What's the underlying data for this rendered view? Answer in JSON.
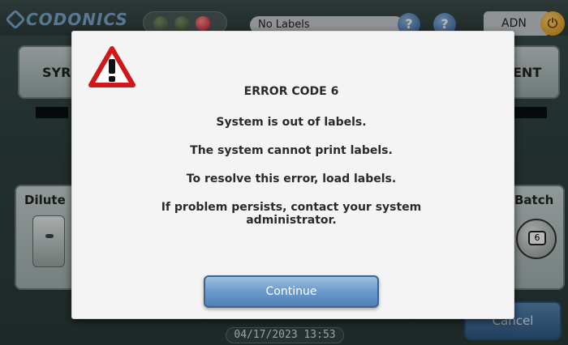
{
  "app": {
    "logo_text": "CODONICS",
    "label_status": "No Labels",
    "user": "ADN",
    "help_icon": "question-icon",
    "power_icon": "power-icon"
  },
  "background": {
    "left_tab_label": "SYR",
    "right_tab_label": "ENT",
    "left_panel_title": "Dilute",
    "right_panel_title": "Batch",
    "batch_count": "6",
    "cancel_label": "Cancel",
    "datetime": "04/17/2023 13:53"
  },
  "dialog": {
    "icon": "warning-triangle-icon",
    "error_code": "ERROR CODE 6",
    "line1": "System is out of labels.",
    "line2": "The system cannot print labels.",
    "line3": "To resolve this error, load labels.",
    "line4a": "If problem persists, contact your system",
    "line4b": "administrator.",
    "continue_label": "Continue"
  },
  "colors": {
    "accent": "#4f82b8",
    "warning_red": "#d01818",
    "status_red_light": "#c81e28"
  }
}
